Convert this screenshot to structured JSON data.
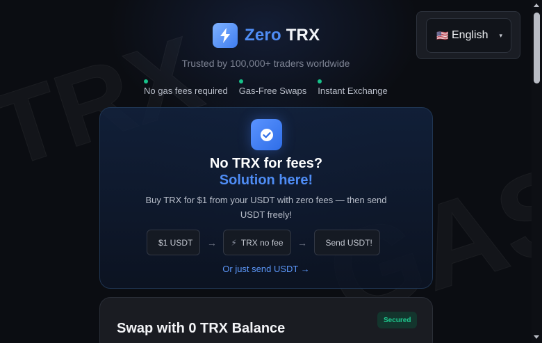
{
  "header": {
    "brand_zero": "Zero",
    "brand_trx": "TRX",
    "tagline": "Trusted by 100,000+ traders worldwide",
    "features": [
      "No gas fees required",
      "Gas-Free Swaps",
      "Instant Exchange"
    ]
  },
  "language": {
    "flag": "🇺🇸",
    "selected": "English"
  },
  "background": {
    "watermark_left": "TRX",
    "watermark_right": "GAS"
  },
  "promo": {
    "icon": "check-circle-icon",
    "title": "No TRX for fees?",
    "subtitle": "Solution here!",
    "description": "Buy TRX for $1 from your USDT with zero fees — then send USDT freely!",
    "steps": [
      {
        "icon": "",
        "label": "$1 USDT"
      },
      {
        "icon": "⚡",
        "label": "TRX no fee"
      },
      {
        "icon": "",
        "label": "Send USDT!"
      }
    ],
    "arrow": "→",
    "link": "Or just send USDT →"
  },
  "swap": {
    "title": "Swap with 0 TRX Balance",
    "badge": "Secured"
  },
  "colors": {
    "accent": "#4f8df5",
    "success": "#1fc98f",
    "background": "#0b0d12"
  }
}
